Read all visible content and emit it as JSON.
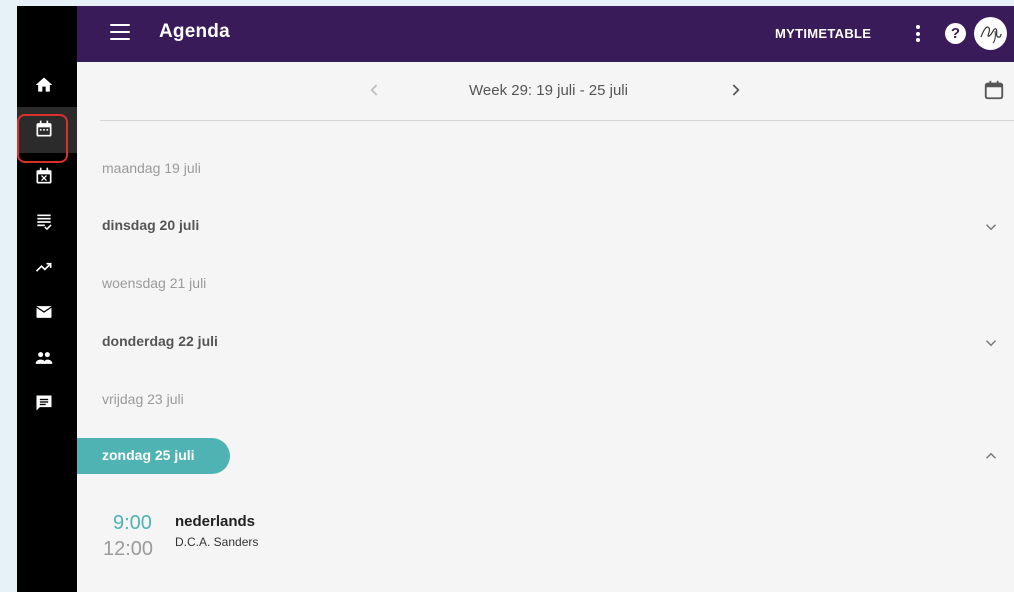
{
  "topbar": {
    "title": "Agenda",
    "mytimetable_label": "MYTIMETABLE",
    "help_label": "?",
    "background": "#3a1b5a"
  },
  "sidebar": {
    "items": [
      {
        "icon": "home-icon"
      },
      {
        "icon": "calendar-icon",
        "active": true
      },
      {
        "icon": "calendar-cancel-icon"
      },
      {
        "icon": "list-check-icon"
      },
      {
        "icon": "trending-up-icon"
      },
      {
        "icon": "mail-icon"
      },
      {
        "icon": "people-icon"
      },
      {
        "icon": "message-icon"
      }
    ]
  },
  "week": {
    "label": "Week 29: 19 juli - 25 juli"
  },
  "days": [
    {
      "label": "maandag 19 juli",
      "bold": false,
      "expandable": false
    },
    {
      "label": "dinsdag 20 juli",
      "bold": true,
      "expandable": true
    },
    {
      "label": "woensdag 21 juli",
      "bold": false,
      "expandable": false
    },
    {
      "label": "donderdag 22 juli",
      "bold": true,
      "expandable": true
    },
    {
      "label": "vrijdag 23 juli",
      "bold": false,
      "expandable": false
    }
  ],
  "today": {
    "label": "zondag 25 juli",
    "color": "#4fb3b3"
  },
  "events": [
    {
      "start": "9:00",
      "end": "12:00",
      "subject": "nederlands",
      "teacher": "D.C.A. Sanders"
    }
  ],
  "colors": {
    "accent": "#4fb3b3",
    "highlight_box": "#d9302b"
  }
}
